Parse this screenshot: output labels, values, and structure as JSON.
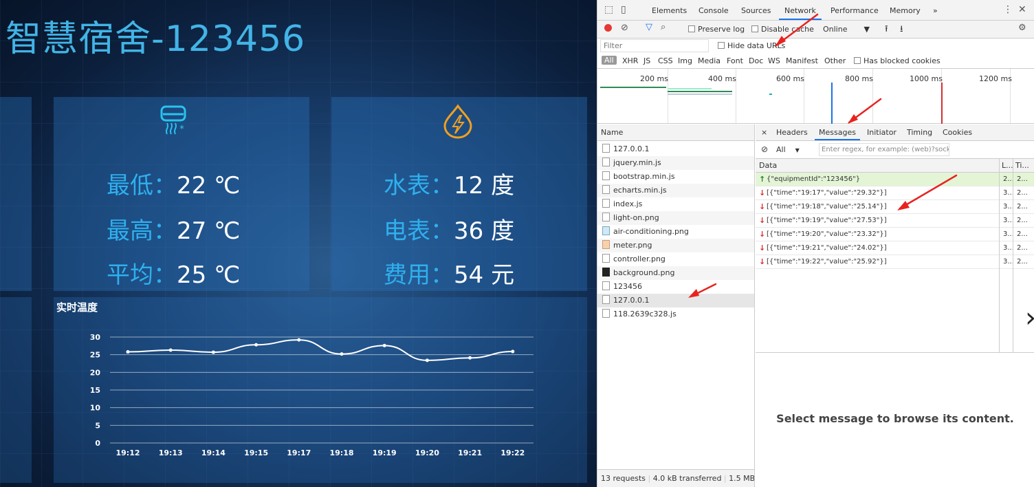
{
  "dashboard": {
    "title": "智慧宿舍-123456",
    "ac": {
      "min": {
        "label": "最低：",
        "value": "22 ℃"
      },
      "max": {
        "label": "最高：",
        "value": "27 ℃"
      },
      "avg": {
        "label": "平均：",
        "value": "25 ℃"
      }
    },
    "meter": {
      "water": {
        "label": "水表：",
        "value": "12 度"
      },
      "power": {
        "label": "电表：",
        "value": "36 度"
      },
      "cost": {
        "label": "费用：",
        "value": "54 元"
      }
    },
    "icons": {
      "ac": "air-conditioner-icon",
      "meter": "water-drop-lightning-icon"
    },
    "colors": {
      "label": "#2fb0ee",
      "title": "#42b4e6",
      "value": "#ffffff"
    }
  },
  "chart_data": {
    "type": "line",
    "title": "实时温度",
    "categories": [
      "19:12",
      "19:13",
      "19:14",
      "19:15",
      "19:17",
      "19:18",
      "19:19",
      "19:20",
      "19:21",
      "19:22"
    ],
    "series": [
      {
        "values": [
          25.8,
          26.3,
          25.7,
          27.8,
          29.2,
          25.2,
          27.6,
          23.4,
          24.1,
          25.9
        ]
      }
    ],
    "yticks": [
      "0",
      "5",
      "10",
      "15",
      "20",
      "25",
      "30"
    ],
    "ylim": [
      0,
      30
    ],
    "grid": true,
    "color": "#ffffff"
  },
  "devtools": {
    "tabs": [
      "Elements",
      "Console",
      "Sources",
      "Network",
      "Performance",
      "Memory",
      "»"
    ],
    "active_tab": "Network",
    "toolbar": {
      "preserve_log": "Preserve log",
      "disable_cache": "Disable cache",
      "throttle": "Online"
    },
    "filter": {
      "placeholder": "Filter",
      "hide_data_urls": "Hide data URLs"
    },
    "types": [
      "All",
      "XHR",
      "JS",
      "CSS",
      "Img",
      "Media",
      "Font",
      "Doc",
      "WS",
      "Manifest",
      "Other"
    ],
    "has_blocked_cookies": "Has blocked cookies",
    "timeline_labels": [
      "200 ms",
      "400 ms",
      "600 ms",
      "800 ms",
      "1000 ms",
      "1200 ms"
    ],
    "name_header": "Name",
    "requests": [
      "127.0.0.1",
      "jquery.min.js",
      "bootstrap.min.js",
      "echarts.min.js",
      "index.js",
      "light-on.png",
      "air-conditioning.png",
      "meter.png",
      "controller.png",
      "background.png",
      "123456",
      "127.0.0.1",
      "118.2639c328.js"
    ],
    "status_bar": {
      "requests": "13 requests",
      "transferred": "4.0 kB transferred",
      "size": "1.5 MB"
    },
    "detail_tabs": [
      "×",
      "Headers",
      "Messages",
      "Initiator",
      "Timing",
      "Cookies"
    ],
    "active_detail_tab": "Messages",
    "msg_filter": {
      "select": "All",
      "placeholder": "Enter regex, for example: (web)?sock"
    },
    "msg_columns": {
      "data": "Data",
      "length": "L...",
      "time": "Ti..."
    },
    "messages": [
      {
        "dir": "up",
        "data": "{\"equipmentId\":\"123456\"}",
        "len": "2...",
        "time": "2..."
      },
      {
        "dir": "down",
        "data": "[{\"time\":\"19:17\",\"value\":\"29.32\"}]",
        "len": "3...",
        "time": "2..."
      },
      {
        "dir": "down",
        "data": "[{\"time\":\"19:18\",\"value\":\"25.14\"}]",
        "len": "3...",
        "time": "2..."
      },
      {
        "dir": "down",
        "data": "[{\"time\":\"19:19\",\"value\":\"27.53\"}]",
        "len": "3...",
        "time": "2..."
      },
      {
        "dir": "down",
        "data": "[{\"time\":\"19:20\",\"value\":\"23.32\"}]",
        "len": "3...",
        "time": "2..."
      },
      {
        "dir": "down",
        "data": "[{\"time\":\"19:21\",\"value\":\"24.02\"}]",
        "len": "3...",
        "time": "2..."
      },
      {
        "dir": "down",
        "data": "[{\"time\":\"19:22\",\"value\":\"25.92\"}]",
        "len": "3...",
        "time": "2..."
      }
    ],
    "empty_message": "Select message to browse its content."
  }
}
